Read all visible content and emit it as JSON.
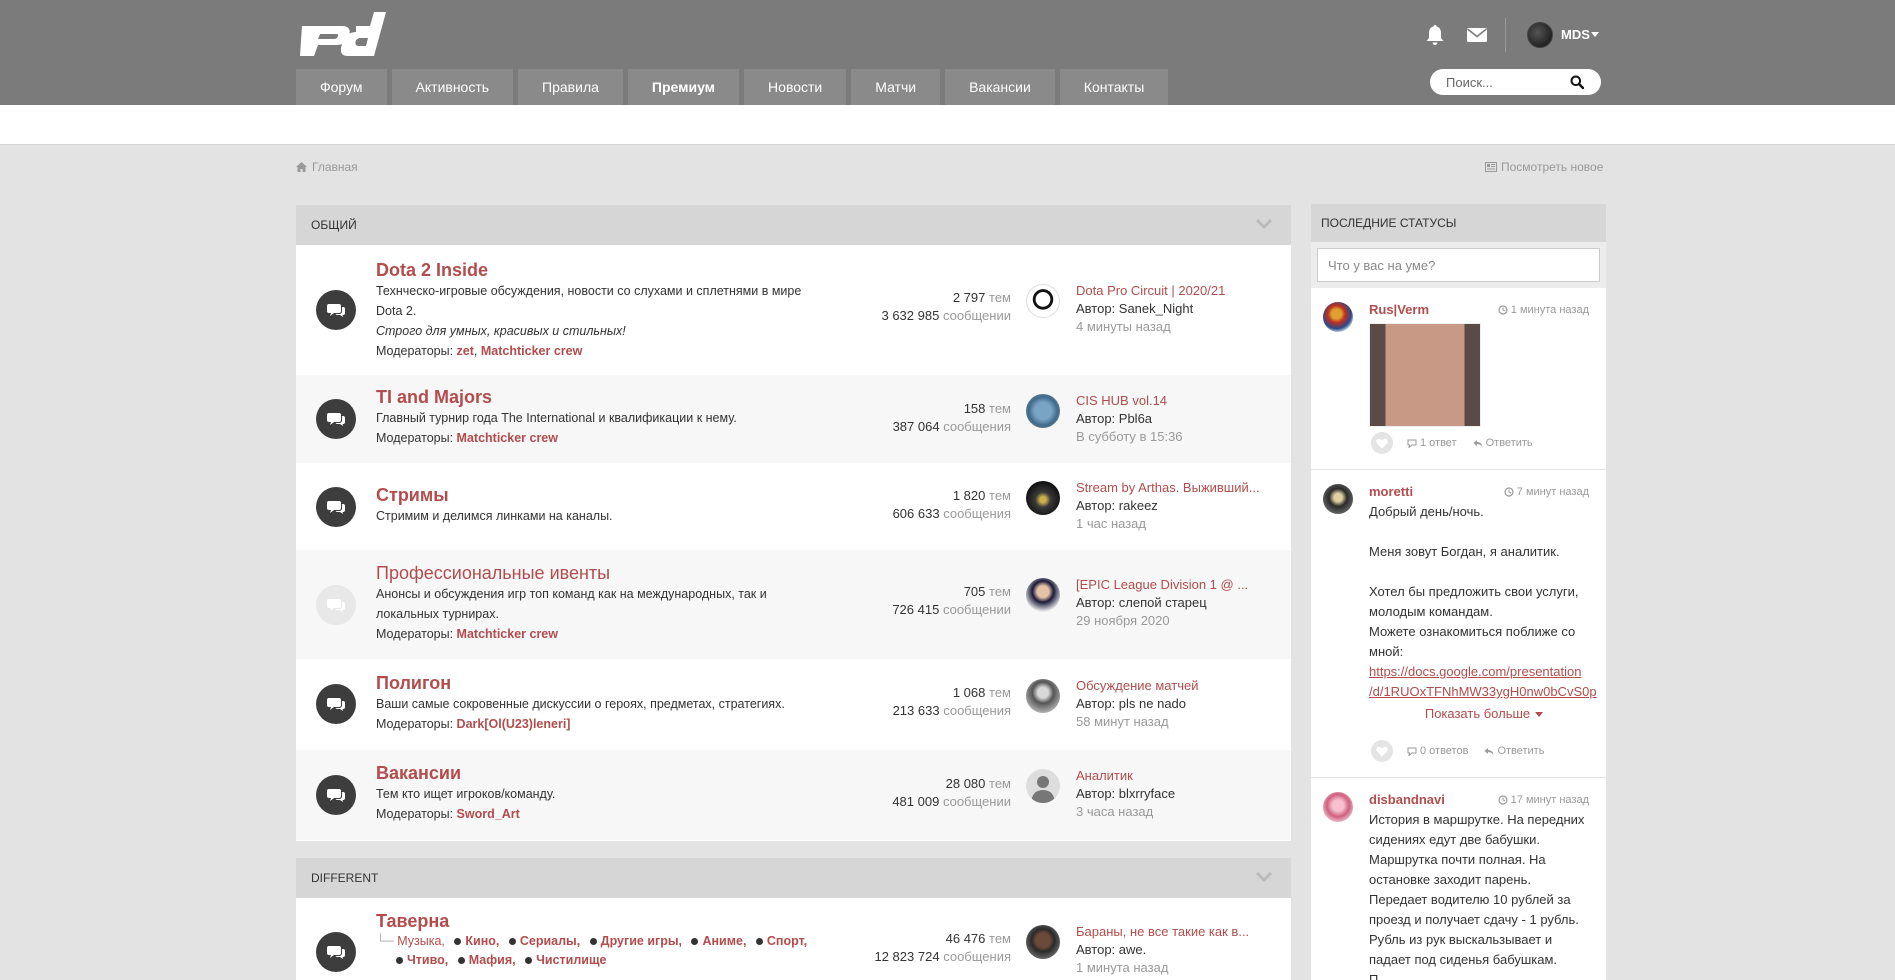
{
  "header": {
    "user_name": "MDS",
    "search_placeholder": "Поиск..."
  },
  "nav": [
    "Форум",
    "Активность",
    "Правила",
    "Премиум",
    "Новости",
    "Матчи",
    "Вакансии",
    "Контакты"
  ],
  "breadcrumb": {
    "home": "Главная",
    "view_new": "Посмотреть новое"
  },
  "categories": [
    {
      "title": "ОБЩИЙ",
      "forums": [
        {
          "title": "Dota 2 Inside",
          "desc_lines": [
            "Технческо-игровые обсуждения, новости со слухами и сплетнями в мире",
            "Dota 2."
          ],
          "tagline": "Строго для умных, красивых и стильных!",
          "mods_label": "Модераторы:",
          "mods": [
            "zet",
            "Matchticker crew"
          ],
          "topics": "2 797",
          "topics_label": "тем",
          "posts": "3 632 985",
          "posts_label": "сообщении",
          "last_title": "Dota Pro Circuit | 2020/21",
          "last_author": "Автор: Sanek_Night",
          "last_time": "4 минуты назад"
        },
        {
          "title": "TI and Majors",
          "desc_lines": [
            "Главный турнир года The International и квалификации к нему."
          ],
          "mods_label": "Модераторы:",
          "mods": [
            "Matchticker crew"
          ],
          "topics": "158",
          "topics_label": "тем",
          "posts": "387 064",
          "posts_label": "сообщения",
          "last_title": "CIS HUB vol.14",
          "last_author": "Автор: Pbl6a",
          "last_time": "В субботу в 15:36"
        },
        {
          "title": "Стримы",
          "desc_lines": [
            "Стримим и делимся линками на каналы."
          ],
          "topics": "1 820",
          "topics_label": "тем",
          "posts": "606 633",
          "posts_label": "сообщения",
          "last_title": "Stream by Arthas. Выживший...",
          "last_author": "Автор: rakeez",
          "last_time": "1 час назад"
        },
        {
          "title": "Профессиональные ивенты",
          "desc_lines": [
            "Анонсы и обсуждения игр топ команд как на международных, так и",
            "локальных турнирах."
          ],
          "mods_label": "Модераторы:",
          "mods": [
            "Matchticker crew"
          ],
          "topics": "705",
          "topics_label": "тем",
          "posts": "726 415",
          "posts_label": "сообщении",
          "last_title": "[EPIC League Division 1 @ ...",
          "last_author": "Автор: слепой старец",
          "last_time": "29 ноября 2020"
        },
        {
          "title": "Полигон",
          "desc_lines": [
            "Ваши самые сокровенные дискуссии о героях, предметах, стратегиях."
          ],
          "mods_label": "Модераторы:",
          "mods": [
            "Dark[Ol(U23)leneri]"
          ],
          "topics": "1 068",
          "topics_label": "тем",
          "posts": "213 633",
          "posts_label": "сообщения",
          "last_title": "Обсуждение матчей",
          "last_author": "Автор: pls ne nado",
          "last_time": "58 минут назад"
        },
        {
          "title": "Вакансии",
          "desc_lines": [
            "Тем кто ищет игроков/команду."
          ],
          "mods_label": "Модераторы:",
          "mods": [
            "Sword_Art"
          ],
          "topics": "28 080",
          "topics_label": "тем",
          "posts": "481 009",
          "posts_label": "сообщении",
          "last_title": "Аналитик",
          "last_author": "Автор: blxrryface",
          "last_time": "3 часа назад"
        }
      ]
    },
    {
      "title": "DIFFERENT",
      "forums": [
        {
          "title": "Таверна",
          "subforums": [
            "Музыка,",
            "Кино,",
            "Сериалы,",
            "Другие игры,",
            "Аниме,",
            "Спорт,",
            "Чтиво,",
            "Мафия,",
            "Чистилище"
          ],
          "topics": "46 476",
          "topics_label": "тем",
          "posts": "12 823 724",
          "posts_label": "сообщения",
          "last_title": "Бараны, не все такие как в...",
          "last_author": "Автор: awe.",
          "last_time": "1 минута назад"
        }
      ]
    }
  ],
  "sidebar": {
    "title": "ПОСЛЕДНИЕ СТАТУСЫ",
    "placeholder": "Что у вас на уме?",
    "statuses": [
      {
        "name": "Rus|Verm",
        "time": "1 минута назад",
        "replies": "1 ответ",
        "reply": "Ответить"
      },
      {
        "name": "moretti",
        "time": "7 минут назад",
        "lines": [
          "Добрый день/ночь.",
          "",
          "Меня зовут Богдан, я аналитик.",
          "",
          "Хотел бы предложить свои услуги,",
          "молодым командам.",
          "Можете ознакомиться поближе со",
          "мной:"
        ],
        "link_lines": [
          "https://docs.google.com/presentation",
          "/d/1RUOxTFNhMW33ygH0nw0bCvS0p"
        ],
        "show_more": "Показать больше",
        "replies": "0 ответов",
        "reply": "Ответить"
      },
      {
        "name": "disbandnavi",
        "time": "17 минут назад",
        "lines": [
          "История в маршрутке. На передних",
          "сидениях едут две бабушки.",
          "Маршрутка почти полная. На",
          "остановке заходит парень.",
          "Передает водителю 10 рублей за",
          "проезд и получает сдачу - 1 рубль.",
          "Рубль из рук выскальзывает и",
          "падает под сиденья бабушкам.",
          "П..."
        ]
      }
    ]
  }
}
